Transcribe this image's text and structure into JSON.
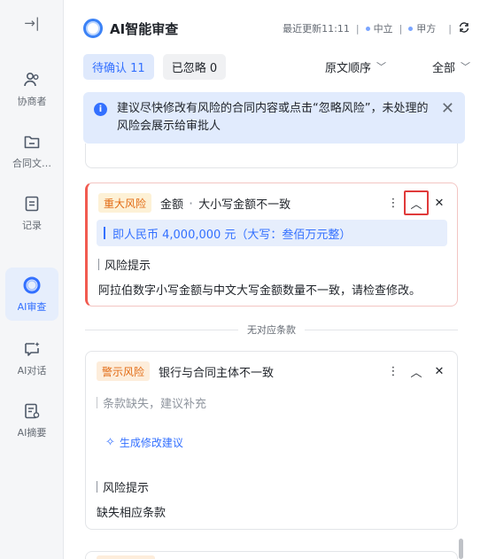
{
  "rail": {
    "top_icon": "→|",
    "items": [
      {
        "label": "协商者",
        "icon": "users-icon"
      },
      {
        "label": "合同文…",
        "icon": "folder-icon"
      },
      {
        "label": "记录",
        "icon": "document-icon"
      },
      {
        "label": "AI审查",
        "icon": "ai-ring-icon"
      },
      {
        "label": "AI对话",
        "icon": "chat-sparkle-icon"
      },
      {
        "label": "AI摘要",
        "icon": "summary-icon"
      }
    ]
  },
  "header": {
    "title": "AI智能审查",
    "updated": "最近更新11:11",
    "sep": "|",
    "party_neutral": "中立",
    "party_a": "甲方",
    "refresh_icon": "refresh-icon"
  },
  "filters": {
    "pending": "待确认 11",
    "ignored": "已忽略 0",
    "order": "原文顺序",
    "scope": "全部"
  },
  "notice": {
    "text": "建议尽快修改有风险的合同内容或点击“忽略风险”，未处理的风险会展示给审批人"
  },
  "card_major": {
    "tag": "重大风险",
    "field": "金额",
    "desc": "大小写金额不一致",
    "quote": "即人民币 4,000,000 元（大写：叁佰万元整）",
    "section_label": "风险提示",
    "body": "阿拉伯数字小写金额与中文大写金额数量不一致，请检查修改。"
  },
  "divider": {
    "text": "无对应条款"
  },
  "card_warn": {
    "tag": "警示风险",
    "title": "银行与合同主体不一致",
    "note": "条款缺失，建议补充",
    "gen": "生成修改建议",
    "section_label": "风险提示",
    "body": "缺失相应条款"
  },
  "colors": {
    "accent": "#3370ff",
    "danger": "#f15b50",
    "warning": "#e26b14"
  }
}
